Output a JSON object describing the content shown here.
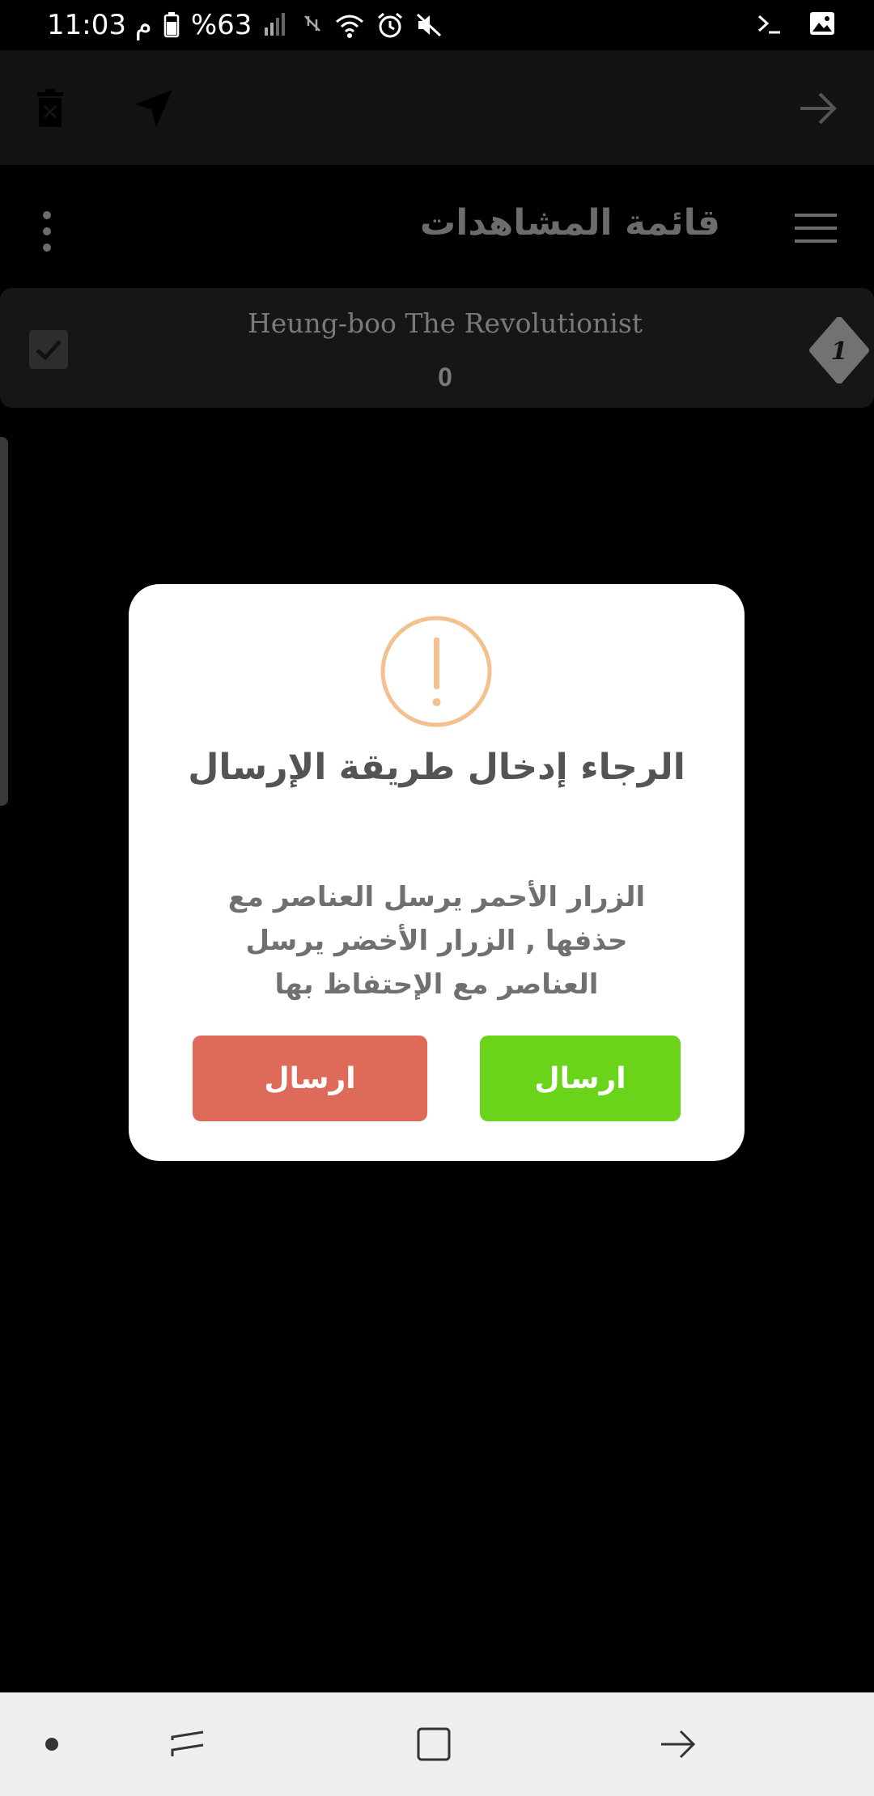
{
  "status_bar": {
    "time": "11:03 م",
    "battery": "%63",
    "icons": [
      "battery-icon",
      "signal-icon",
      "data-off-icon",
      "wifi-icon",
      "alarm-icon",
      "mute-icon",
      "terminal-icon",
      "gallery-icon"
    ]
  },
  "action_bar": {
    "icons": [
      "delete-icon",
      "navigation-arrow-icon",
      "arrow-forward-icon"
    ]
  },
  "header": {
    "title": "قائمة المشاهدات"
  },
  "list": {
    "items": [
      {
        "title": "Heung-boo The Revolutionist",
        "count": "0",
        "badge": "1"
      }
    ]
  },
  "dialog": {
    "title": "الرجاء إدخال طريقة الإرسال",
    "message": "الزرار الأحمر يرسل العناصر مع حذفها , الزرار الأخضر يرسل العناصر مع الإحتفاظ بها",
    "green_button": "ارسال",
    "red_button": "ارسال",
    "colors": {
      "green": "#6ad41b",
      "red": "#de6a5a",
      "warning": "#f3c08e"
    }
  },
  "nav_bar": {
    "icons": [
      "dot-icon",
      "recent-apps-icon",
      "home-icon",
      "back-icon"
    ]
  }
}
